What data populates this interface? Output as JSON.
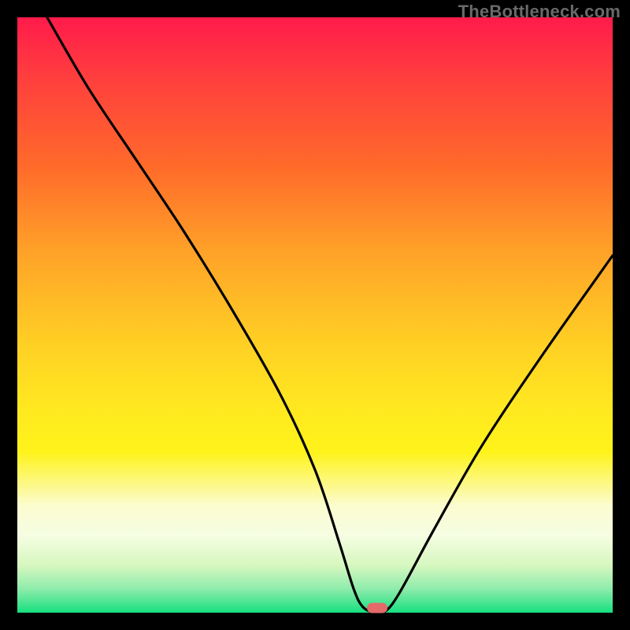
{
  "watermark": "TheBottleneck.com",
  "chart_data": {
    "type": "line",
    "title": "",
    "xlabel": "",
    "ylabel": "",
    "xlim": [
      0,
      100
    ],
    "ylim": [
      0,
      100
    ],
    "grid": false,
    "series": [
      {
        "name": "bottleneck-curve",
        "x": [
          5,
          12,
          20,
          28,
          36,
          44,
          50,
          54,
          56.5,
          58,
          60,
          61.5,
          64,
          70,
          78,
          88,
          100
        ],
        "y": [
          100,
          88,
          76,
          64,
          51,
          37,
          24,
          12,
          4,
          1,
          0,
          0,
          3,
          14,
          28,
          43,
          60
        ]
      }
    ],
    "marker": {
      "x": 60.5,
      "y": 0.8,
      "color": "#e46a6a"
    },
    "gradient_stops": [
      {
        "pos": 0,
        "color": "#ff1b4b"
      },
      {
        "pos": 25,
        "color": "#ff6a2a"
      },
      {
        "pos": 55,
        "color": "#ffd024"
      },
      {
        "pos": 73,
        "color": "#fff31a"
      },
      {
        "pos": 100,
        "color": "#16e080"
      }
    ]
  }
}
